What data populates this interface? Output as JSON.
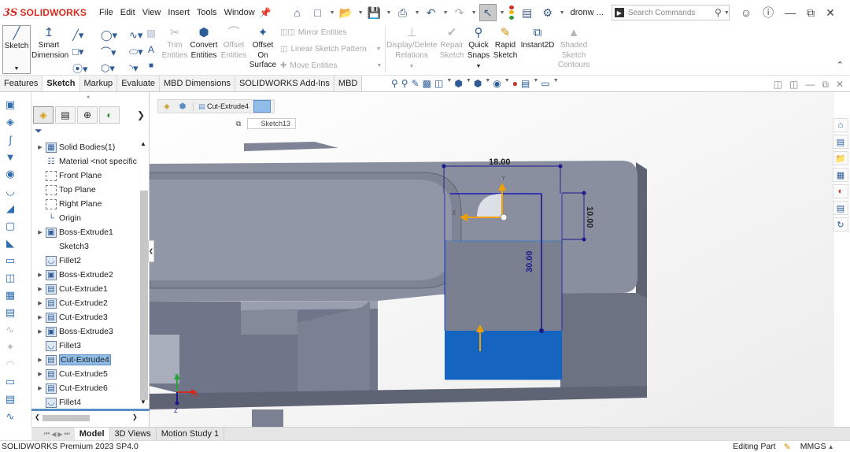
{
  "app": {
    "logo_mark": "3S",
    "logo_name": "SOLIDWORKS",
    "document_name": "dronw ..."
  },
  "menu": [
    "File",
    "Edit",
    "View",
    "Insert",
    "Tools",
    "Window"
  ],
  "search": {
    "placeholder": "Search Commands"
  },
  "ribbon": {
    "sketch": "Sketch",
    "smart_dimension": "Smart\nDimension",
    "trim_entities": "Trim\nEntities",
    "convert_entities": "Convert\nEntities",
    "offset_entities": "Offset\nEntities",
    "offset_on_surface": "Offset\nOn\nSurface",
    "mirror_entities": "Mirror Entities",
    "linear_sketch_pattern": "Linear Sketch Pattern",
    "move_entities": "Move Entities",
    "display_delete_relations": "Display/Delete\nRelations",
    "repair_sketch": "Repair\nSketch",
    "quick_snaps": "Quick\nSnaps",
    "rapid_sketch": "Rapid\nSketch",
    "instant2d": "Instant2D",
    "shaded_sketch_contours": "Shaded\nSketch\nContours"
  },
  "command_tabs": [
    {
      "label": "Features",
      "active": false
    },
    {
      "label": "Sketch",
      "active": true
    },
    {
      "label": "Markup",
      "active": false
    },
    {
      "label": "Evaluate",
      "active": false
    },
    {
      "label": "MBD Dimensions",
      "active": false
    },
    {
      "label": "SOLIDWORKS Add-Ins",
      "active": false
    },
    {
      "label": "MBD",
      "active": false
    }
  ],
  "feature_tree": [
    {
      "label": "Solid Bodies(1)",
      "icon": "solid-bodies-icon",
      "expandable": true,
      "selected": false
    },
    {
      "label": "Material <not specific",
      "icon": "material-icon",
      "expandable": false,
      "selected": false
    },
    {
      "label": "Front Plane",
      "icon": "plane-icon",
      "expandable": false,
      "selected": false
    },
    {
      "label": "Top Plane",
      "icon": "plane-icon",
      "expandable": false,
      "selected": false
    },
    {
      "label": "Right Plane",
      "icon": "plane-icon",
      "expandable": false,
      "selected": false
    },
    {
      "label": "Origin",
      "icon": "origin-icon",
      "expandable": false,
      "selected": false
    },
    {
      "label": "Boss-Extrude1",
      "icon": "boss-extrude-icon",
      "expandable": true,
      "selected": false
    },
    {
      "label": "Sketch3",
      "icon": "sketch-icon",
      "expandable": false,
      "selected": false
    },
    {
      "label": "Fillet2",
      "icon": "fillet-icon",
      "expandable": false,
      "selected": false
    },
    {
      "label": "Boss-Extrude2",
      "icon": "boss-extrude-icon",
      "expandable": true,
      "selected": false
    },
    {
      "label": "Cut-Extrude1",
      "icon": "cut-extrude-icon",
      "expandable": true,
      "selected": false
    },
    {
      "label": "Cut-Extrude2",
      "icon": "cut-extrude-icon",
      "expandable": true,
      "selected": false
    },
    {
      "label": "Cut-Extrude3",
      "icon": "cut-extrude-icon",
      "expandable": true,
      "selected": false
    },
    {
      "label": "Boss-Extrude3",
      "icon": "boss-extrude-icon",
      "expandable": true,
      "selected": false
    },
    {
      "label": "Fillet3",
      "icon": "fillet-icon",
      "expandable": false,
      "selected": false
    },
    {
      "label": "Cut-Extrude4",
      "icon": "cut-extrude-icon",
      "expandable": true,
      "selected": true
    },
    {
      "label": "Cut-Extrude5",
      "icon": "cut-extrude-icon",
      "expandable": true,
      "selected": false
    },
    {
      "label": "Cut-Extrude6",
      "icon": "cut-extrude-icon",
      "expandable": true,
      "selected": false
    },
    {
      "label": "Fillet4",
      "icon": "fillet-icon",
      "expandable": false,
      "selected": false
    }
  ],
  "breadcrumb": {
    "feature": "Cut-Extrude4",
    "sketch": "Sketch13"
  },
  "dimensions": {
    "width": "18.00",
    "height": "10.00",
    "depth": "30.00"
  },
  "triad": {
    "x": "X",
    "y": "Y",
    "z": "Z"
  },
  "bottom_tabs": [
    {
      "label": "Model",
      "active": true
    },
    {
      "label": "3D Views",
      "active": false
    },
    {
      "label": "Motion Study 1",
      "active": false
    }
  ],
  "status": {
    "version": "SOLIDWORKS Premium 2023 SP4.0",
    "mode": "Editing Part",
    "units": "MMGS"
  },
  "colors": {
    "brand": "#d52b1e",
    "selection": "#8fbde8",
    "sketch_fill": "#1565c0",
    "dimension": "#1a1a8c"
  }
}
